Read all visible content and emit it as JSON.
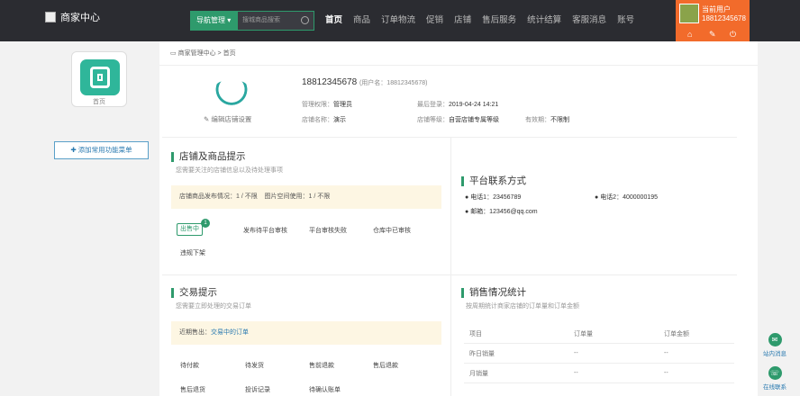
{
  "header": {
    "logo_text": "商家中心",
    "nav_button": "导航管理",
    "search_placeholder": "搜城商品搜索",
    "menu": [
      "首页",
      "商品",
      "订单物流",
      "促销",
      "店铺",
      "售后服务",
      "统计结算",
      "客服消息",
      "账号"
    ],
    "user": {
      "name": "当前用户",
      "id": "18812345678",
      "icons": [
        "home-icon",
        "wrench-icon",
        "logout-icon"
      ]
    }
  },
  "sidebar": {
    "app_label": "首页",
    "add_button": "添加常用功能菜单"
  },
  "breadcrumb": {
    "root": "商家管理中心",
    "sep": ">",
    "current": "首页"
  },
  "profile": {
    "account": "18812345678",
    "username": "(用户名：18812345678)",
    "edit_shop": "编辑店铺设置",
    "role_label": "管理权限：",
    "role": "管理员",
    "last_login_label": "最后登录：",
    "last_login": "2019-04-24 14:21",
    "shop_label": "店铺名称：",
    "shop": "演示",
    "level_label": "店铺等级：",
    "level": "自营店铺专属等级",
    "valid_label": "有效期：",
    "valid": "不限制"
  },
  "shop_notice": {
    "title": "店铺及商品提示",
    "subtitle": "您需要关注的店铺信息以及待处理事项",
    "publish": "店铺商品发布情况：1 / 不限",
    "space": "图片空间使用：1 / 不限",
    "chip": "出售中",
    "badge": "1",
    "links": [
      "发布待平台审核",
      "平台审核失败",
      "仓库中已审核",
      "违规下架"
    ]
  },
  "platform": {
    "title": "平台联系方式",
    "phone1": "电话1：23456789",
    "phone2": "电话2：4000000195",
    "email": "邮箱：123456@qq.com"
  },
  "trade": {
    "title": "交易提示",
    "subtitle": "您需要立即处理的交易订单",
    "recent_label": "近期售出：",
    "recent_link": "交易中的订单",
    "items": [
      "待付款",
      "待发货",
      "售前退款",
      "售后退款",
      "售后退货",
      "投诉记录",
      "待确认账单"
    ]
  },
  "sales": {
    "title": "销售情况统计",
    "subtitle": "按周期统计商家店铺的订单量和订单金额",
    "headers": [
      "项目",
      "订单量",
      "订单金额"
    ],
    "rows": [
      [
        "昨日销量",
        "--",
        "--"
      ],
      [
        "月销量",
        "--",
        "--"
      ]
    ]
  },
  "floating": {
    "msg": "站内消息",
    "online": "在线联系"
  }
}
